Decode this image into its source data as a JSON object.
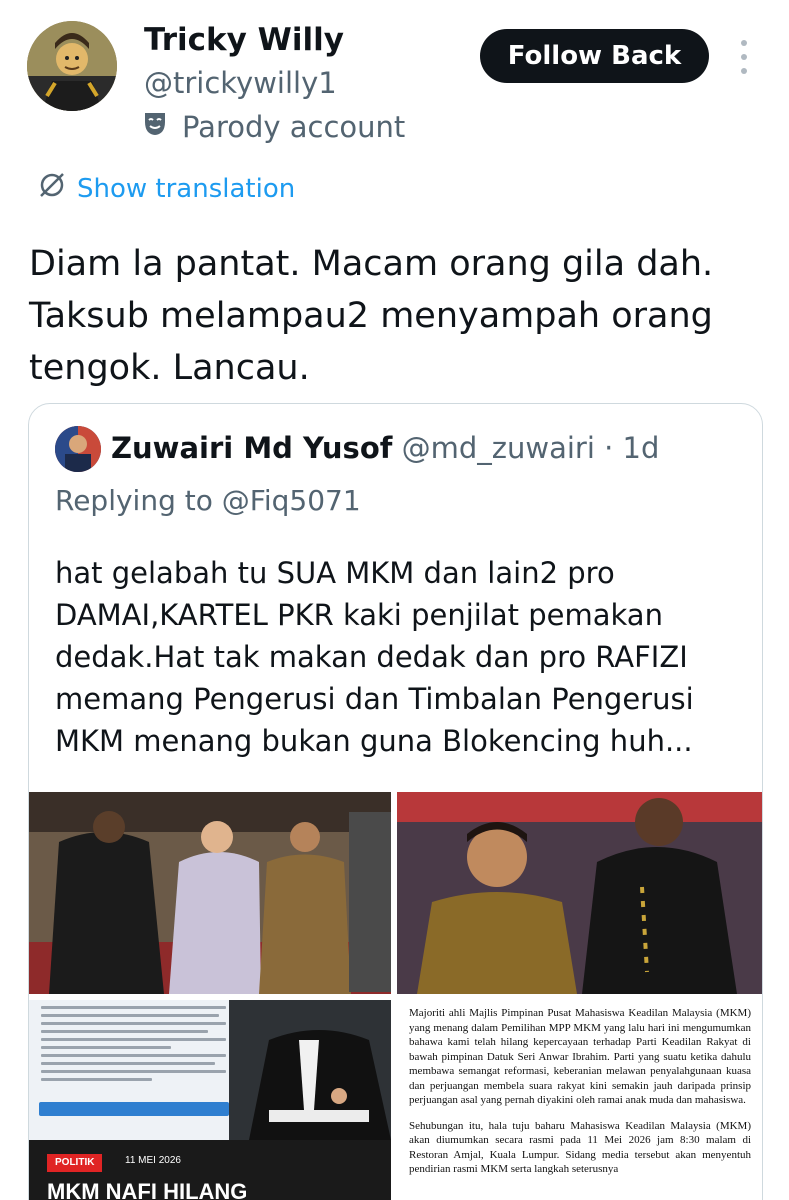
{
  "tweet": {
    "author_name": "Tricky Willy",
    "author_handle": "@trickywilly1",
    "badge_label": "Parody account",
    "follow_label": "Follow Back",
    "translation_label": "Show translation",
    "text": "Diam la pantat. Macam orang gila dah. Taksub melampau2 menyampah orang tengok. Lancau."
  },
  "icons": {
    "more": "more-vertical-icon",
    "parody": "theater-mask-icon",
    "translate": "translate-icon"
  },
  "colors": {
    "accent": "#1d9bf0",
    "text_primary": "#0f1419",
    "text_secondary": "#536471",
    "button_bg": "#0f1419"
  },
  "quote": {
    "author_name": "Zuwairi Md Yusof",
    "author_handle": "@md_zuwairi",
    "time": "· 1d",
    "replying_to": "Replying to @Fiq5071",
    "text": "hat gelabah tu SUA MKM dan lain2 pro DAMAI,KARTEL PKR kaki penjilat pemakan dedak.Hat tak makan dedak dan pro RAFIZI memang Pengerusi dan Timbalan Pengerusi MKM menang bukan guna Blokencing huh..."
  },
  "media": {
    "news_badge": "POLITIK",
    "news_date": "11 MEI 2026",
    "news_headline": "MKM NAFI HILANG KEPERCAYAAN TERHADAP",
    "doc_paragraph_1": "Majoriti ahli Majlis Pimpinan Pusat Mahasiswa Keadilan Malaysia (MKM) yang menang dalam Pemilihan MPP MKM yang lalu hari ini mengumumkan bahawa kami telah hilang kepercayaan terhadap Parti Keadilan Rakyat di bawah pimpinan Datuk Seri Anwar Ibrahim. Parti yang suatu ketika dahulu membawa semangat reformasi, keberanian melawan penyalahgunaan kuasa dan perjuangan membela suara rakyat kini semakin jauh daripada prinsip perjuangan asal yang pernah diyakini oleh ramai anak muda dan mahasiswa.",
    "doc_paragraph_2": "Sehubungan itu, hala tuju baharu Mahasiswa Keadilan Malaysia (MKM) akan diumumkan secara rasmi pada 11 Mei 2026 jam 8:30 malam di Restoran Amjal, Kuala Lumpur. Sidang media tersebut akan menyentuh pendirian rasmi MKM serta langkah seterusnya"
  }
}
